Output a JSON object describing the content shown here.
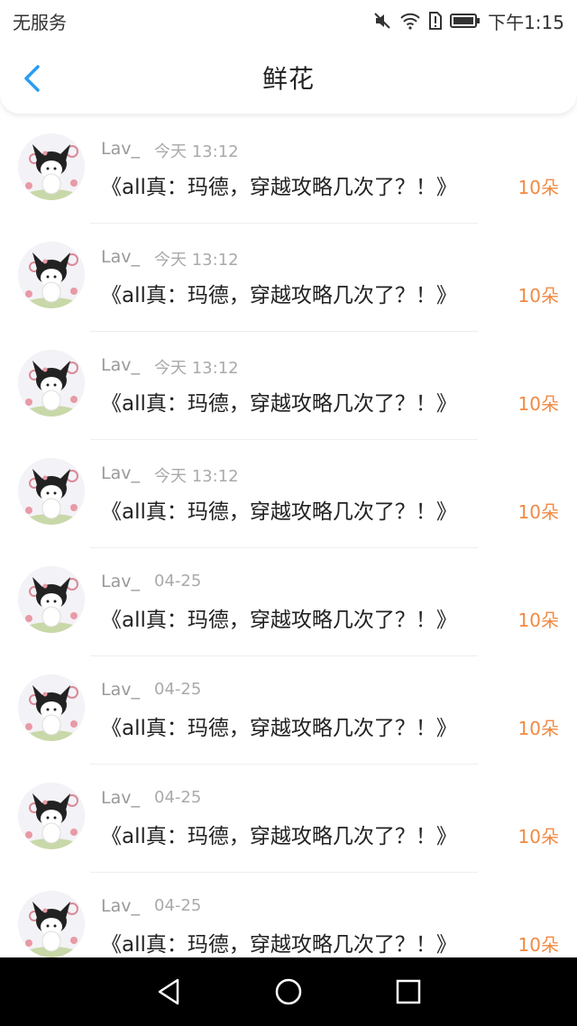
{
  "status_bar": {
    "carrier": "无服务",
    "time": "下午1:15",
    "icons": [
      "mute-icon",
      "wifi-icon",
      "alert-sim-icon",
      "battery-icon"
    ]
  },
  "header": {
    "title": "鲜花",
    "back_icon": "chevron-left-icon"
  },
  "colors": {
    "accent": "#2a9df4",
    "flower_count": "#f08a44"
  },
  "items": [
    {
      "username": "Lav_",
      "time": "今天 13:12",
      "book": "《all真：玛德，穿越攻略几次了？！》",
      "count": "10朵"
    },
    {
      "username": "Lav_",
      "time": "今天 13:12",
      "book": "《all真：玛德，穿越攻略几次了？！》",
      "count": "10朵"
    },
    {
      "username": "Lav_",
      "time": "今天 13:12",
      "book": "《all真：玛德，穿越攻略几次了？！》",
      "count": "10朵"
    },
    {
      "username": "Lav_",
      "time": "今天 13:12",
      "book": "《all真：玛德，穿越攻略几次了？！》",
      "count": "10朵"
    },
    {
      "username": "Lav_",
      "time": "04-25",
      "book": "《all真：玛德，穿越攻略几次了？！》",
      "count": "10朵"
    },
    {
      "username": "Lav_",
      "time": "04-25",
      "book": "《all真：玛德，穿越攻略几次了？！》",
      "count": "10朵"
    },
    {
      "username": "Lav_",
      "time": "04-25",
      "book": "《all真：玛德，穿越攻略几次了？！》",
      "count": "10朵"
    },
    {
      "username": "Lav_",
      "time": "04-25",
      "book": "《all真：玛德，穿越攻略几次了？！》",
      "count": "10朵"
    }
  ],
  "nav_bar": {
    "icons": [
      "back-triangle-icon",
      "home-circle-icon",
      "recents-square-icon"
    ]
  }
}
